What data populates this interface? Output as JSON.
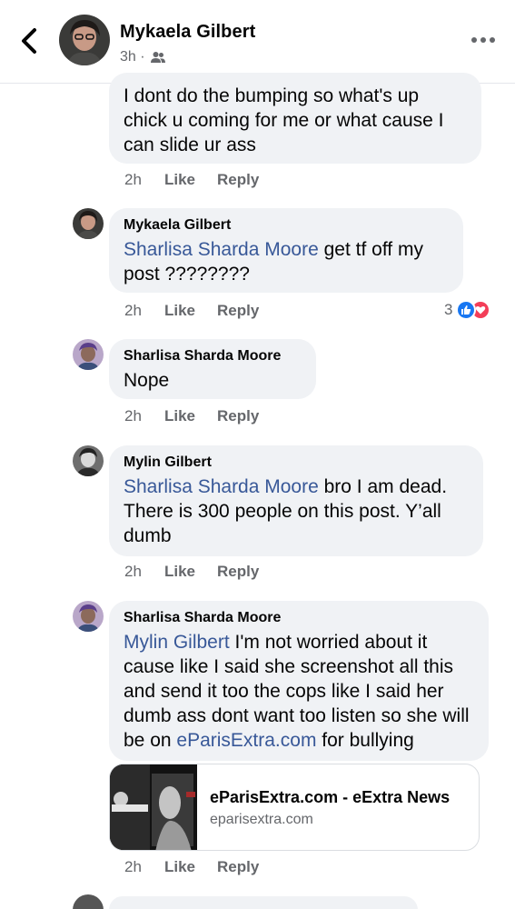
{
  "header": {
    "name": "Mykaela Gilbert",
    "time": "3h ·"
  },
  "comments": [
    {
      "text": "I dont do the bumping so what's up chick u coming for me or what cause I can slide ur ass",
      "time": "2h",
      "like": "Like",
      "reply": "Reply"
    },
    {
      "author": "Mykaela Gilbert",
      "mention": "Sharlisa Sharda Moore",
      "text": " get tf off my post ????????",
      "time": "2h",
      "like": "Like",
      "reply": "Reply",
      "reaction_count": "3"
    },
    {
      "author": "Sharlisa Sharda Moore",
      "text": "Nope",
      "time": "2h",
      "like": "Like",
      "reply": "Reply"
    },
    {
      "author": "Mylin Gilbert",
      "mention": "Sharlisa Sharda Moore",
      "text": " bro I am dead. There is 300 people on this post. Y’all dumb",
      "time": "2h",
      "like": "Like",
      "reply": "Reply"
    },
    {
      "author": "Sharlisa Sharda Moore",
      "mention": "Mylin Gilbert",
      "text": " I'm not worried about it cause like I said she screenshot all this and send it too the cops like I said her dumb ass dont want too listen so she will be on ",
      "link": "eParisExtra.com",
      "text_after": " for bullying",
      "time": "2h",
      "like": "Like",
      "reply": "Reply"
    }
  ],
  "preview": {
    "title": "eParisExtra.com - eExtra News",
    "domain": "eparisextra.com"
  },
  "colors": {
    "bubble": "#f0f2f5",
    "mention": "#385898",
    "meta": "#65676b",
    "like_blue": "#1877f2",
    "love_red": "#f33e58"
  },
  "icons": {
    "back": "chevron-left-icon",
    "audience": "friends-icon",
    "more": "more-dots-icon",
    "like": "thumbs-up-icon",
    "love": "heart-icon"
  }
}
